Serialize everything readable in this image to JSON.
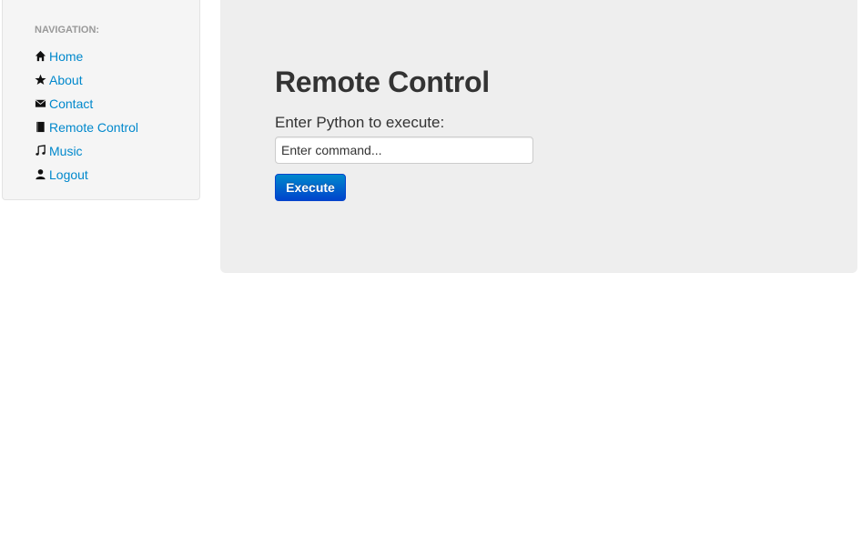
{
  "sidebar": {
    "header": "NAVIGATION:",
    "items": [
      {
        "label": "Home",
        "icon": "home-icon"
      },
      {
        "label": "About",
        "icon": "star-icon"
      },
      {
        "label": "Contact",
        "icon": "envelope-icon"
      },
      {
        "label": "Remote Control",
        "icon": "book-icon"
      },
      {
        "label": "Music",
        "icon": "music-icon"
      },
      {
        "label": "Logout",
        "icon": "user-icon"
      }
    ]
  },
  "main": {
    "title": "Remote Control",
    "prompt_label": "Enter Python to execute:",
    "command_input": {
      "value": "",
      "placeholder": "Enter command..."
    },
    "execute_label": "Execute"
  },
  "colors": {
    "link": "#0088cc",
    "button_top": "#0088cc",
    "button_bottom": "#0044cc",
    "hero_bg": "#eeeeee",
    "sidebar_bg": "#f5f5f5"
  }
}
